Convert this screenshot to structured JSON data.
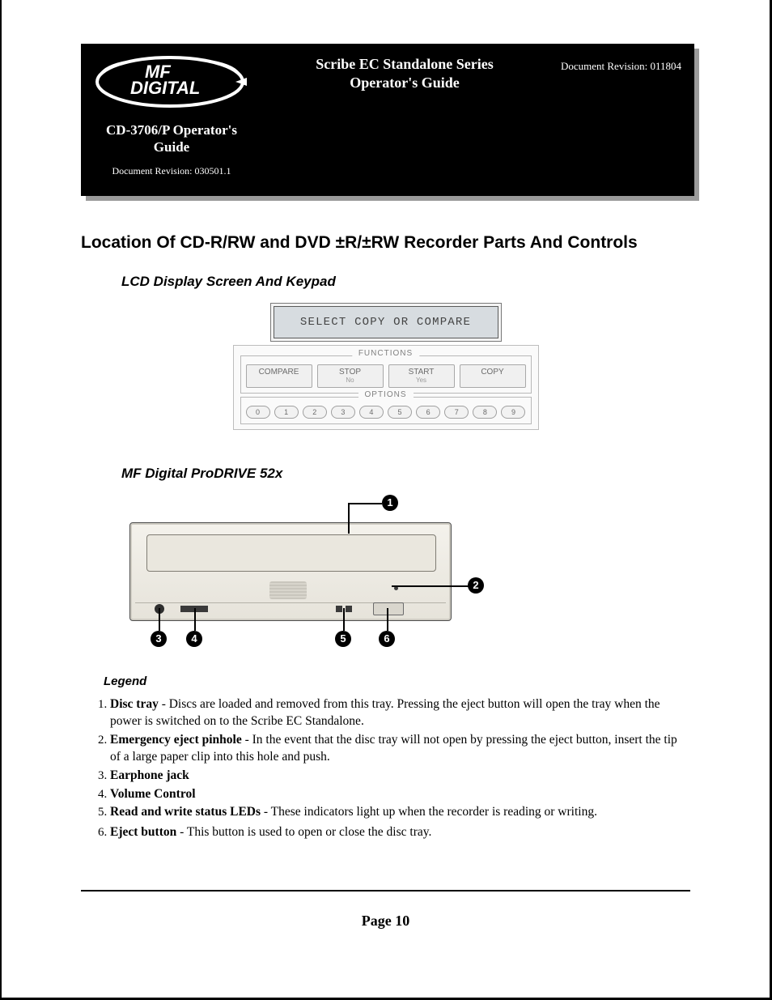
{
  "header": {
    "logo_text_line1": "MF",
    "logo_text_line2": "DIGITAL",
    "series_title_line1": "Scribe EC Standalone Series",
    "series_title_line2": "Operator's Guide",
    "doc_revision_right": "Document Revision: 011804",
    "subdoc_title_line1": "CD-3706/P Operator's",
    "subdoc_title_line2": "Guide",
    "subdoc_revision": "Document Revision: 030501.1"
  },
  "headings": {
    "h1": "Location Of CD-R/RW and DVD ±R/±RW Recorder Parts And Controls",
    "h2_keypad": "LCD Display Screen And Keypad",
    "h2_drive": "MF Digital ProDRIVE 52x",
    "h3_legend": "Legend"
  },
  "keypad": {
    "lcd_text": "SELECT COPY OR COMPARE",
    "functions_label": "FUNCTIONS",
    "options_label": "OPTIONS",
    "buttons": {
      "compare": "COMPARE",
      "stop": "STOP",
      "stop_sub": "No",
      "start": "START",
      "start_sub": "Yes",
      "copy": "COPY"
    },
    "option_keys": [
      "0",
      "1",
      "2",
      "3",
      "4",
      "5",
      "6",
      "7",
      "8",
      "9"
    ]
  },
  "drive": {
    "callouts": [
      "1",
      "2",
      "3",
      "4",
      "5",
      "6"
    ]
  },
  "legend": [
    {
      "term": "Disc tray",
      "desc": " - Discs are loaded and removed from this tray. Pressing the eject button will open the tray when the power is switched on to the Scribe EC Standalone."
    },
    {
      "term": "Emergency eject pinhole",
      "desc": " - In the event that the disc tray will not open by pressing the eject button, insert the tip of a large paper clip into this hole and push."
    },
    {
      "term": "Earphone jack",
      "desc": ""
    },
    {
      "term": "Volume Control",
      "desc": ""
    },
    {
      "term": "Read and write status LEDs",
      "desc": " - These indicators light up when the recorder is reading or writing."
    },
    {
      "term": "Eject button",
      "desc": " - This button is used to open or close the disc tray."
    }
  ],
  "footer": {
    "page_label": "Page 10"
  }
}
